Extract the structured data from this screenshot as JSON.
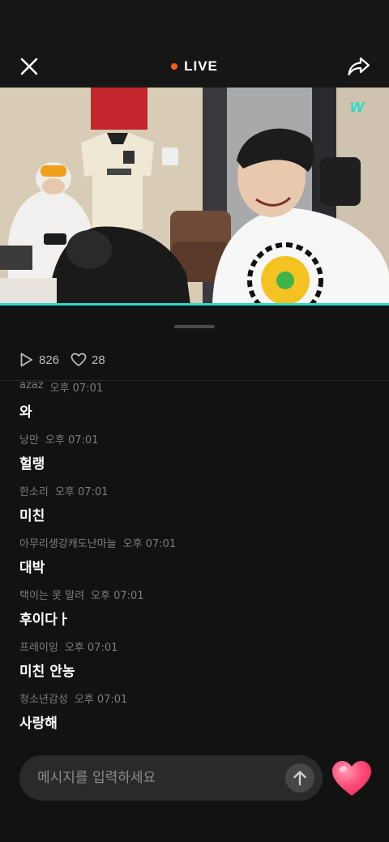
{
  "header": {
    "live_label": "LIVE",
    "close_icon": "close-icon",
    "share_icon": "share-icon",
    "live_dot_color": "#ff5a1f",
    "brand_icon": "weverse-w-logo"
  },
  "video": {
    "progress_color": "#2fd8c4"
  },
  "stats": {
    "views": "826",
    "likes": "28",
    "views_icon": "play-icon",
    "likes_icon": "heart-outline-icon"
  },
  "chat": {
    "messages": [
      {
        "user": "azaz",
        "time": "오후 07:01",
        "text": "와"
      },
      {
        "user": "낭만",
        "time": "오후 07:01",
        "text": "헐랭"
      },
      {
        "user": "한소리",
        "time": "오후 07:01",
        "text": "미친"
      },
      {
        "user": "아무리생강캐도난마늘",
        "time": "오후 07:01",
        "text": "대박"
      },
      {
        "user": "택이는 못 말려",
        "time": "오후 07:01",
        "text": "후이다ㅏ"
      },
      {
        "user": "프레이잉",
        "time": "오후 07:01",
        "text": "미친 안농"
      },
      {
        "user": "청소년감성",
        "time": "오후 07:01",
        "text": "사랑해"
      }
    ]
  },
  "composer": {
    "placeholder": "메시지를 입력하세요",
    "send_icon": "arrow-up-icon",
    "heart_icon": "heart-reaction-icon",
    "heart_color": "#ff4f7b"
  }
}
